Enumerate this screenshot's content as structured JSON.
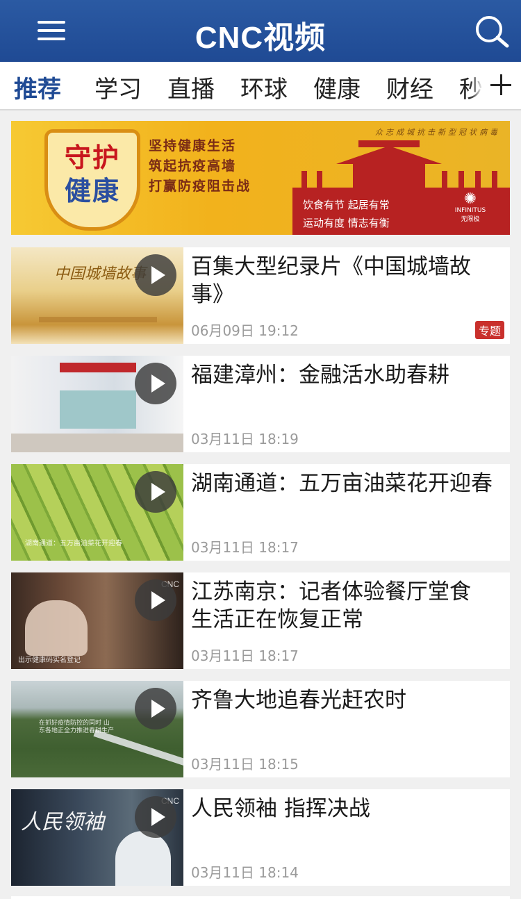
{
  "header": {
    "brand": "CNC视频"
  },
  "tabs": [
    {
      "label": "推荐",
      "active": true
    },
    {
      "label": "学习"
    },
    {
      "label": "直播"
    },
    {
      "label": "环球"
    },
    {
      "label": "健康"
    },
    {
      "label": "财经"
    },
    {
      "label": "秒"
    }
  ],
  "banner": {
    "shield_line1": "守护",
    "shield_line2": "健康",
    "slogan": [
      "坚持健康生活",
      "筑起抗疫高墙",
      "打赢防疫阻击战"
    ],
    "tiny_text": "众志成城抗击新型冠状病毒",
    "wall_text_1": "饮食有节   起居有常",
    "wall_text_2": "运动有度   情志有衡",
    "sponsor_en": "INFINITUS",
    "sponsor_cn": "无限极"
  },
  "feed": [
    {
      "title": "百集大型纪录片《中国城墙故事》",
      "time": "06月09日 19:12",
      "badge": "专题",
      "thumb_caption": "中国城墙故事"
    },
    {
      "title": "福建漳州：金融活水助春耕",
      "time": "03月11日 18:19"
    },
    {
      "title": "湖南通道：五万亩油菜花开迎春",
      "time": "03月11日 18:17",
      "thumb_caption": "湖南通道：五万亩油菜花开迎春"
    },
    {
      "title": "江苏南京：记者体验餐厅堂食 生活正在恢复正常",
      "time": "03月11日 18:17",
      "thumb_caption": "出示健康码实名登记",
      "thumb_logo": "CNC"
    },
    {
      "title": "齐鲁大地追春光赶农时",
      "time": "03月11日 18:15",
      "thumb_caption": "在抓好疫情防控的同时 山东各地正全力推进春耕生产"
    },
    {
      "title": "人民领袖 指挥决战",
      "time": "03月11日 18:14",
      "thumb_caption": "人民领袖",
      "thumb_logo": "CNC"
    }
  ],
  "colors": {
    "header_bg": "#1f4a94",
    "active_tab": "#1f4a94",
    "badge": "#c9302c"
  }
}
